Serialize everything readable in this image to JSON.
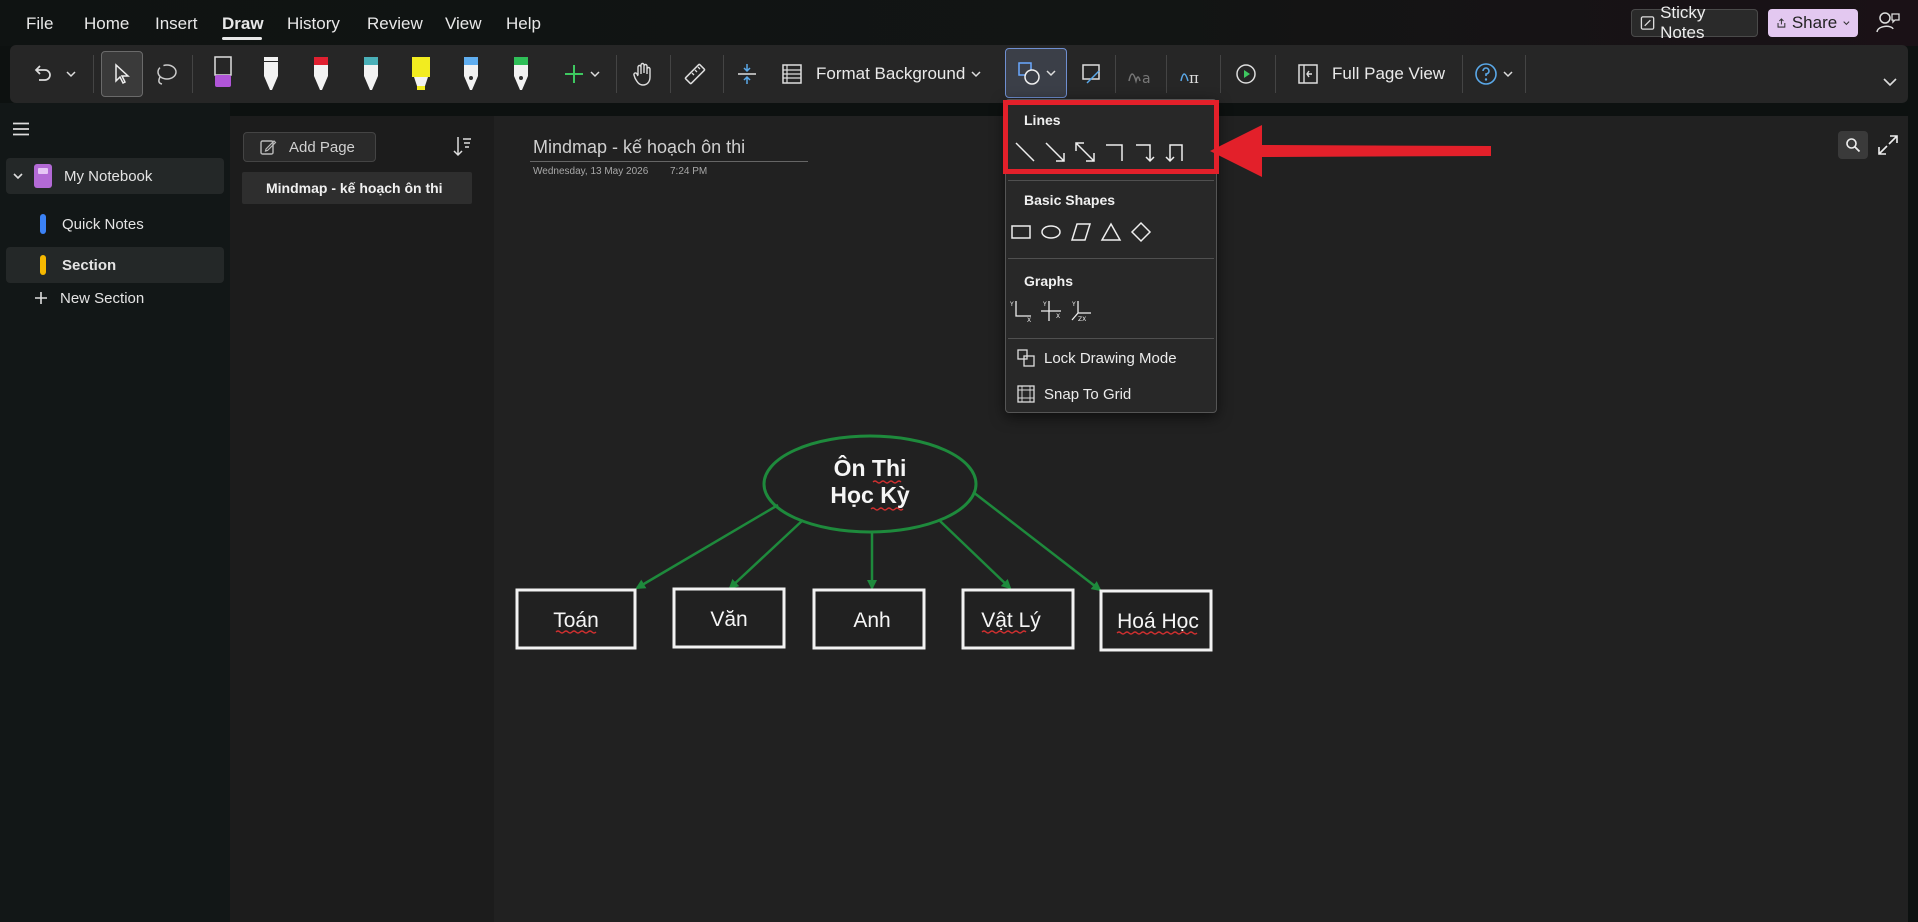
{
  "menubar": {
    "items": [
      "File",
      "Home",
      "Insert",
      "Draw",
      "History",
      "Review",
      "View",
      "Help"
    ],
    "active": "Draw",
    "sticky_notes": "Sticky Notes",
    "share": "Share"
  },
  "ribbon": {
    "format_background": "Format Background",
    "full_page_view": "Full Page View"
  },
  "nav": {
    "notebook": "My Notebook",
    "sections": [
      {
        "label": "Quick Notes",
        "color": "#3b82f6"
      },
      {
        "label": "Section",
        "color": "#f5b800"
      }
    ],
    "new_section": "New Section"
  },
  "pagelist": {
    "add_page": "Add Page",
    "pages": [
      "Mindmap - kế hoạch ôn thi"
    ]
  },
  "page": {
    "title": "Mindmap - kế hoạch ôn thi",
    "date": "Wednesday, 13 May 2026",
    "time": "7:24 PM"
  },
  "mindmap": {
    "center": [
      "Ôn Thi",
      "Học Kỳ"
    ],
    "nodes": [
      "Toán",
      "Văn",
      "Anh",
      "Vật Lý",
      "Hoá Học"
    ],
    "line_color": "#1e8a3c",
    "box_color": "#f2f2f2"
  },
  "dropdown": {
    "lines_heading": "Lines",
    "shapes_heading": "Basic Shapes",
    "graphs_heading": "Graphs",
    "lock_drawing": "Lock Drawing Mode",
    "snap_to_grid": "Snap To Grid"
  },
  "colors": {
    "accent_red": "#e3202a",
    "share_bg": "#e3c8f0"
  }
}
